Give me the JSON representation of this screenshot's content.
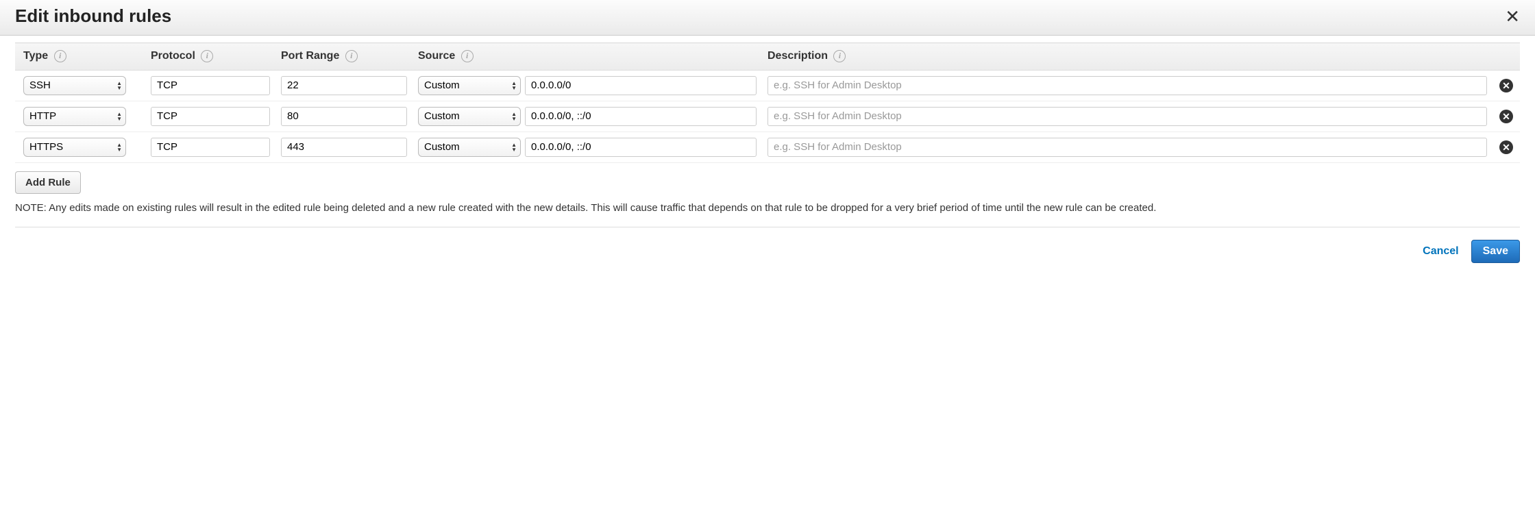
{
  "dialog": {
    "title": "Edit inbound rules"
  },
  "headers": {
    "type": "Type",
    "protocol": "Protocol",
    "portRange": "Port Range",
    "source": "Source",
    "description": "Description"
  },
  "rules": [
    {
      "type": "SSH",
      "protocol": "TCP",
      "portRange": "22",
      "sourceMode": "Custom",
      "sourceValue": "0.0.0.0/0",
      "description": "",
      "descriptionPlaceholder": "e.g. SSH for Admin Desktop"
    },
    {
      "type": "HTTP",
      "protocol": "TCP",
      "portRange": "80",
      "sourceMode": "Custom",
      "sourceValue": "0.0.0.0/0, ::/0",
      "description": "",
      "descriptionPlaceholder": "e.g. SSH for Admin Desktop"
    },
    {
      "type": "HTTPS",
      "protocol": "TCP",
      "portRange": "443",
      "sourceMode": "Custom",
      "sourceValue": "0.0.0.0/0, ::/0",
      "description": "",
      "descriptionPlaceholder": "e.g. SSH for Admin Desktop"
    }
  ],
  "buttons": {
    "addRule": "Add Rule",
    "cancel": "Cancel",
    "save": "Save"
  },
  "note": "NOTE: Any edits made on existing rules will result in the edited rule being deleted and a new rule created with the new details. This will cause traffic that depends on that rule to be dropped for a very brief period of time until the new rule can be created."
}
